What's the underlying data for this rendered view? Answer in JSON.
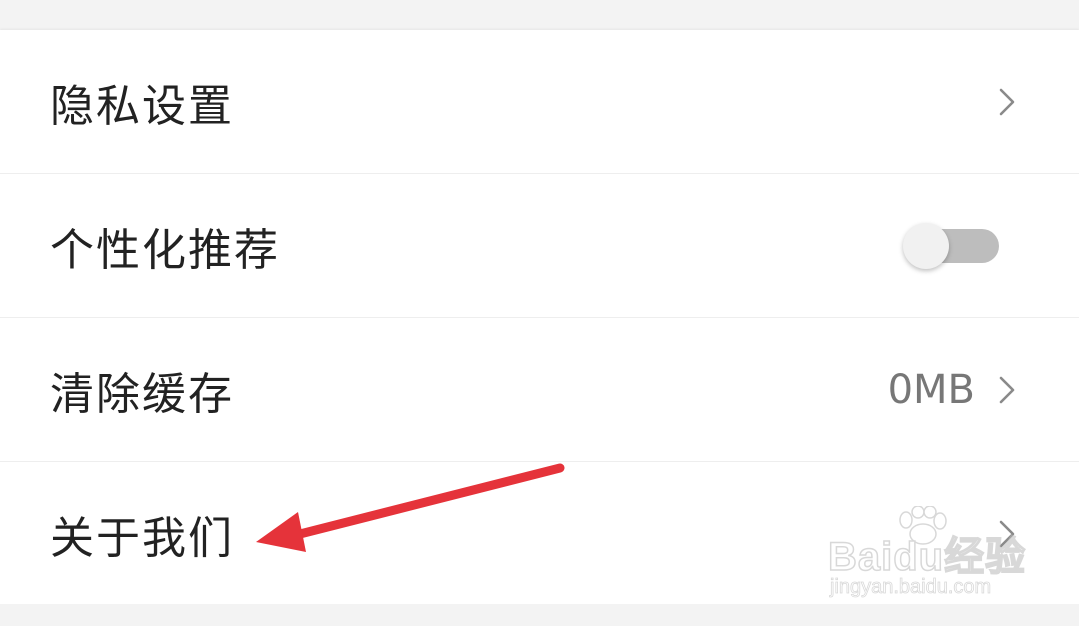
{
  "settings": {
    "items": [
      {
        "label": "隐私设置",
        "control": "chevron"
      },
      {
        "label": "个性化推荐",
        "control": "toggle",
        "toggle_on": false
      },
      {
        "label": "清除缓存",
        "control": "chevron",
        "value": "0MB"
      },
      {
        "label": "关于我们",
        "control": "chevron"
      }
    ]
  },
  "annotation": {
    "arrow_color": "#e5333a",
    "points_to": "关于我们"
  },
  "watermark": {
    "brand": "Baidu经验",
    "url": "jingyan.baidu.com"
  },
  "colors": {
    "background": "#f3f3f3",
    "row_background": "#ffffff",
    "label_text": "#222222",
    "value_text": "#777777",
    "chevron": "#8a8a8a",
    "toggle_track": "#bdbdbd",
    "toggle_thumb": "#f1f1f1"
  },
  "icons": {
    "chevron": "chevron-right-icon"
  }
}
